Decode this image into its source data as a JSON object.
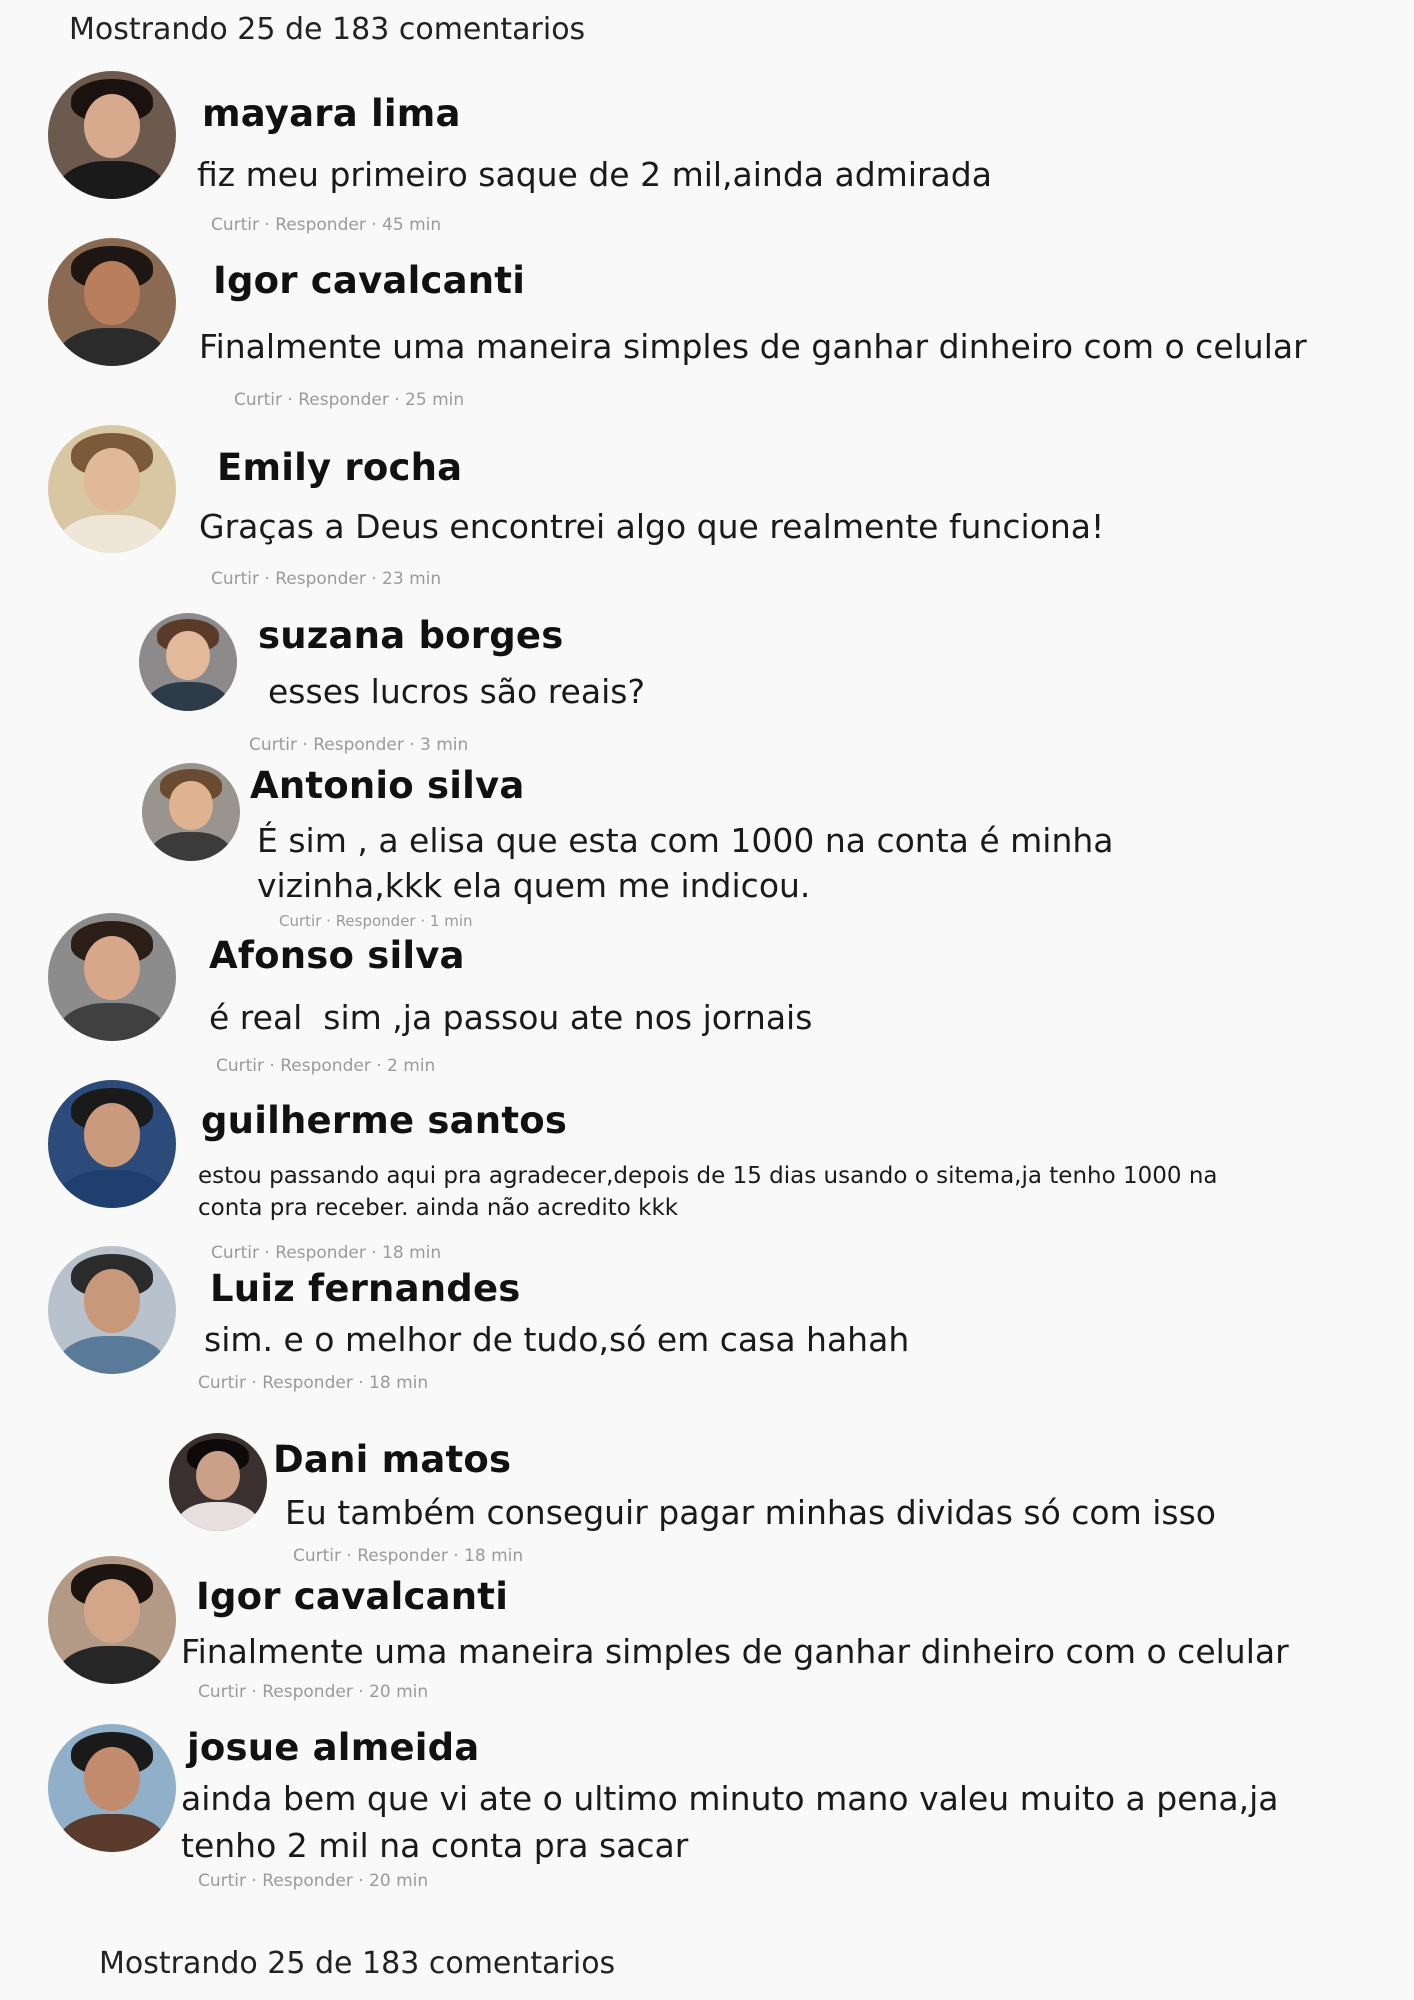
{
  "count_label": "Mostrando 25 de 183 comentarios",
  "actions": {
    "like": "Curtir",
    "reply": "Responder",
    "sep": " · "
  },
  "comments": [
    {
      "author": "mayara lima",
      "text": "fiz meu primeiro saque de 2 mil,ainda admirada",
      "time": "45 min"
    },
    {
      "author": "Igor cavalcanti",
      "text": "Finalmente uma maneira simples de ganhar dinheiro com o celular",
      "time": "25 min"
    },
    {
      "author": "Emily rocha",
      "text": "Graças a Deus encontrei algo que realmente funciona!",
      "time": "23 min"
    },
    {
      "author": "suzana borges",
      "text": "esses lucros são reais?",
      "time": "3 min"
    },
    {
      "author": "Antonio silva",
      "text": "É sim , a elisa que esta com 1000 na conta é minha vizinha,kkk ela quem me indicou.",
      "time": "1 min"
    },
    {
      "author": "Afonso silva",
      "text": "é real  sim ,ja passou ate nos jornais",
      "time": "2 min"
    },
    {
      "author": "guilherme santos",
      "text": "estou passando aqui pra agradecer,depois de 15 dias usando o sitema,ja tenho 1000 na conta pra receber. ainda não acredito kkk",
      "time": "18 min"
    },
    {
      "author": "Luiz fernandes",
      "text": "sim. e o melhor de tudo,só em casa hahah",
      "time": "18 min"
    },
    {
      "author": "Dani matos",
      "text": "Eu também conseguir pagar minhas dividas só com isso",
      "time": "18 min"
    },
    {
      "author": "Igor cavalcanti",
      "text": "Finalmente uma maneira simples de ganhar dinheiro com o celular",
      "time": "20 min"
    },
    {
      "author": "josue almeida",
      "text": "ainda bem que vi ate o ultimo minuto mano valeu muito a pena,ja tenho 2 mil na conta pra sacar",
      "time": "20 min"
    }
  ]
}
